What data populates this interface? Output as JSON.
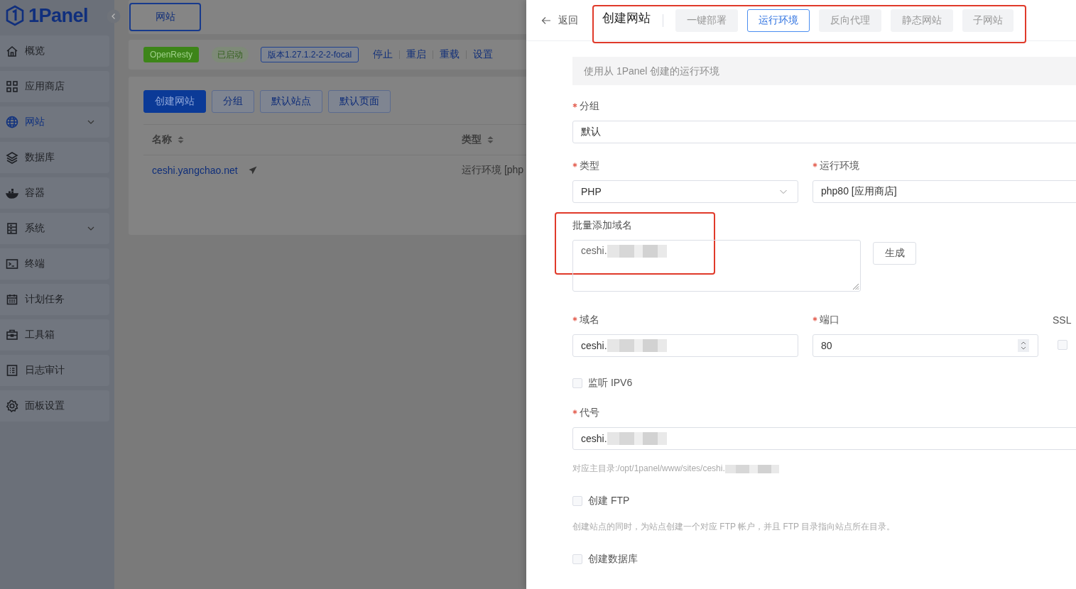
{
  "sidebar": {
    "logo": "1Panel",
    "items": [
      {
        "label": "概览",
        "selected": false,
        "expandable": false
      },
      {
        "label": "应用商店",
        "selected": false,
        "expandable": false
      },
      {
        "label": "网站",
        "selected": true,
        "expandable": true
      },
      {
        "label": "数据库",
        "selected": false,
        "expandable": false
      },
      {
        "label": "容器",
        "selected": false,
        "expandable": false
      },
      {
        "label": "系统",
        "selected": false,
        "expandable": true
      },
      {
        "label": "终端",
        "selected": false,
        "expandable": false
      },
      {
        "label": "计划任务",
        "selected": false,
        "expandable": false
      },
      {
        "label": "工具箱",
        "selected": false,
        "expandable": false
      },
      {
        "label": "日志审计",
        "selected": false,
        "expandable": false
      },
      {
        "label": "面板设置",
        "selected": false,
        "expandable": false
      }
    ]
  },
  "page_tab": "网站",
  "server_bar": {
    "app": "OpenResty",
    "status": "已启动",
    "version": "版本1.27.1.2-2-2-focal",
    "actions": [
      "停止",
      "重启",
      "重载",
      "设置"
    ]
  },
  "toolbar": [
    {
      "label": "创建网站",
      "primary": true
    },
    {
      "label": "分组",
      "primary": false
    },
    {
      "label": "默认站点",
      "primary": false
    },
    {
      "label": "默认页面",
      "primary": false
    }
  ],
  "table": {
    "columns": [
      "名称",
      "类型"
    ],
    "rows": [
      [
        "ceshi.yangchao.net",
        "运行环境 [php"
      ]
    ]
  },
  "drawer": {
    "back": "返回",
    "title": "创建网站",
    "tabs": [
      {
        "label": "一键部署",
        "selected": false
      },
      {
        "label": "运行环境",
        "selected": true
      },
      {
        "label": "反向代理",
        "selected": false
      },
      {
        "label": "静态网站",
        "selected": false
      },
      {
        "label": "子网站",
        "selected": false
      }
    ],
    "alert": "使用从 1Panel 创建的运行环境",
    "rows": [
      {
        "fields": [
          {
            "kind": "input",
            "label": "分组",
            "required": true,
            "value": "默认"
          }
        ]
      },
      {
        "fields": [
          {
            "kind": "select",
            "label": "类型",
            "required": true,
            "value": "PHP"
          },
          {
            "kind": "input",
            "label": "运行环境",
            "required": true,
            "value": "php80 [应用商店]"
          }
        ]
      },
      {
        "fields": [
          {
            "kind": "textarea",
            "label": "批量添加域名",
            "required": false,
            "value": "ceshi.",
            "masked": true
          },
          {
            "kind": "button",
            "label": "生成"
          }
        ]
      },
      {
        "fields": [
          {
            "kind": "input",
            "label": "域名",
            "required": true,
            "value": "ceshi.",
            "masked": true
          },
          {
            "kind": "number",
            "label": "端口",
            "required": true,
            "value": "80"
          },
          {
            "kind": "checkbox",
            "label": "SSL",
            "checked": false
          }
        ]
      },
      {
        "fields": [
          {
            "kind": "check",
            "label": "监听 IPV6",
            "checked": false
          }
        ]
      },
      {
        "fields": [
          {
            "kind": "input",
            "label": "代号",
            "required": true,
            "value": "ceshi.",
            "masked": true
          },
          {
            "kind": "hint",
            "value": "对应主目录:/opt/1panel/www/sites/ceshi.",
            "masked": true
          }
        ]
      },
      {
        "fields": [
          {
            "kind": "check",
            "label": "创建 FTP",
            "checked": false
          },
          {
            "kind": "hint",
            "value": "创建站点的同时，为站点创建一个对应 FTP 帐户，并且 FTP 目录指向站点所在目录。",
            "masked": false
          }
        ]
      },
      {
        "fields": [
          {
            "kind": "check",
            "label": "创建数据库",
            "checked": false
          }
        ]
      }
    ]
  }
}
